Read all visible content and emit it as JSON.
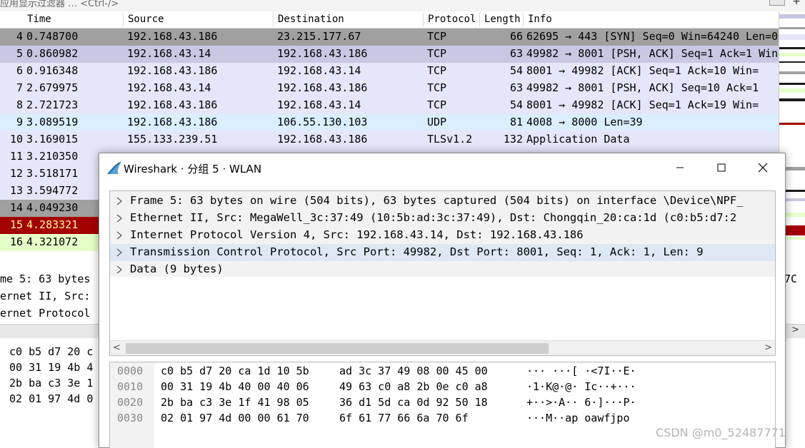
{
  "filter": {
    "placeholder": "应用显示过滤器 … <Ctrl-/>",
    "plus": "+"
  },
  "columns": [
    "Time",
    "Source",
    "Destination",
    "Protocol",
    "Length",
    "Info"
  ],
  "packets": [
    {
      "no": "4",
      "time": "0.748700",
      "src": "192.168.43.186",
      "dst": "23.215.177.67",
      "proto": "TCP",
      "len": "66",
      "info": "62695 → 443 [SYN] Seq=0 Win=64240 Len=0",
      "bg": "#a0a0a0",
      "fg": "#000000"
    },
    {
      "no": "5",
      "time": "0.860982",
      "src": "192.168.43.14",
      "dst": "192.168.43.186",
      "proto": "TCP",
      "len": "63",
      "info": "49982 → 8001 [PSH, ACK] Seq=1 Ack=1 Win",
      "bg": "#c8c8e4",
      "fg": "#000000"
    },
    {
      "no": "6",
      "time": "0.916348",
      "src": "192.168.43.186",
      "dst": "192.168.43.14",
      "proto": "TCP",
      "len": "54",
      "info": "8001 → 49982 [ACK] Seq=1 Ack=10 Win=",
      "bg": "#e6e6fa",
      "fg": "#000000"
    },
    {
      "no": "7",
      "time": "2.679975",
      "src": "192.168.43.14",
      "dst": "192.168.43.186",
      "proto": "TCP",
      "len": "63",
      "info": "49982 → 8001 [PSH, ACK] Seq=10 Ack=1",
      "bg": "#e6e6fa",
      "fg": "#000000"
    },
    {
      "no": "8",
      "time": "2.721723",
      "src": "192.168.43.186",
      "dst": "192.168.43.14",
      "proto": "TCP",
      "len": "54",
      "info": "8001 → 49982 [ACK] Seq=1 Ack=19 Win=",
      "bg": "#e6e6fa",
      "fg": "#000000"
    },
    {
      "no": "9",
      "time": "3.089519",
      "src": "192.168.43.186",
      "dst": "106.55.130.103",
      "proto": "UDP",
      "len": "81",
      "info": "4008 → 8000 Len=39",
      "bg": "#daeeff",
      "fg": "#000000"
    },
    {
      "no": "10",
      "time": "3.169015",
      "src": "155.133.239.51",
      "dst": "192.168.43.186",
      "proto": "TLSv1.2",
      "len": "132",
      "info": "Application Data",
      "bg": "#e6e6fa",
      "fg": "#000000"
    },
    {
      "no": "11",
      "time": "3.210350",
      "src": "",
      "dst": "",
      "proto": "",
      "len": "",
      "info": "",
      "bg": "#e6e6fa",
      "fg": "#000000"
    },
    {
      "no": "12",
      "time": "3.518171",
      "src": "",
      "dst": "",
      "proto": "",
      "len": "",
      "info": "",
      "bg": "#e6e6fa",
      "fg": "#000000"
    },
    {
      "no": "13",
      "time": "3.594772",
      "src": "",
      "dst": "",
      "proto": "",
      "len": "",
      "info": "",
      "bg": "#e6e6fa",
      "fg": "#000000"
    },
    {
      "no": "14",
      "time": "4.049230",
      "src": "",
      "dst": "",
      "proto": "",
      "len": "",
      "info": "",
      "bg": "#a0a0a0",
      "fg": "#000000"
    },
    {
      "no": "15",
      "time": "4.283321",
      "src": "",
      "dst": "",
      "proto": "",
      "len": "",
      "info": "",
      "bg": "#a40000",
      "fg": "#fffc9c"
    },
    {
      "no": "16",
      "time": "4.321072",
      "src": "",
      "dst": "",
      "proto": "",
      "len": "",
      "info": "",
      "bg": "#e4ffc7",
      "fg": "#000000"
    }
  ],
  "detail_behind": [
    "me 5: 63 bytes",
    "ernet II, Src:",
    "ernet Protocol"
  ],
  "detail_behind_right": "7C",
  "bytes_behind": [
    "c0 b5 d7 20 c",
    "00 31 19 4b 4",
    "2b ba c3 3e 1",
    "02 01 97 4d 0"
  ],
  "dialog": {
    "title": "Wireshark · 分组 5 · WLAN",
    "min_label": "—",
    "max_label": "☐",
    "close_label": "✕",
    "tree": [
      "Frame 5: 63 bytes on wire (504 bits), 63 bytes captured (504 bits) on interface \\Device\\NPF_",
      "Ethernet II, Src: MegaWell_3c:37:49 (10:5b:ad:3c:37:49), Dst: Chongqin_20:ca:1d (c0:b5:d7:2",
      "Internet Protocol Version 4, Src: 192.168.43.14, Dst: 192.168.43.186",
      "Transmission Control Protocol, Src Port: 49982, Dst Port: 8001, Seq: 1, Ack: 1, Len: 9",
      "Data (9 bytes)"
    ],
    "hex": [
      {
        "off": "0000",
        "h1": "c0 b5 d7 20 ca 1d 10 5b",
        "h2": "ad 3c 37 49 08 00 45 00",
        "asc": "··· ···[ ·<7I··E·"
      },
      {
        "off": "0010",
        "h1": "00 31 19 4b 40 00 40 06",
        "h2": "49 63 c0 a8 2b 0e c0 a8",
        "asc": "·1·K@·@· Ic··+···"
      },
      {
        "off": "0020",
        "h1": "2b ba c3 3e 1f 41 98 05",
        "h2": "36 d1 5d ca 0d 92 50 18",
        "asc": "+··>·A·· 6·]···P·"
      },
      {
        "off": "0030",
        "h1": "02 01 97 4d 00 00 61 70",
        "h2": "6f 61 77 66 6a 70 6f",
        "asc": "···M··ap oawfjpo"
      }
    ]
  },
  "watermark": "CSDN @m0_52487771",
  "colors": {
    "selected_tree_row": "#dce9f5",
    "dialog_border": "#8a8a8a",
    "shark_fin": "#1f6fb2"
  }
}
